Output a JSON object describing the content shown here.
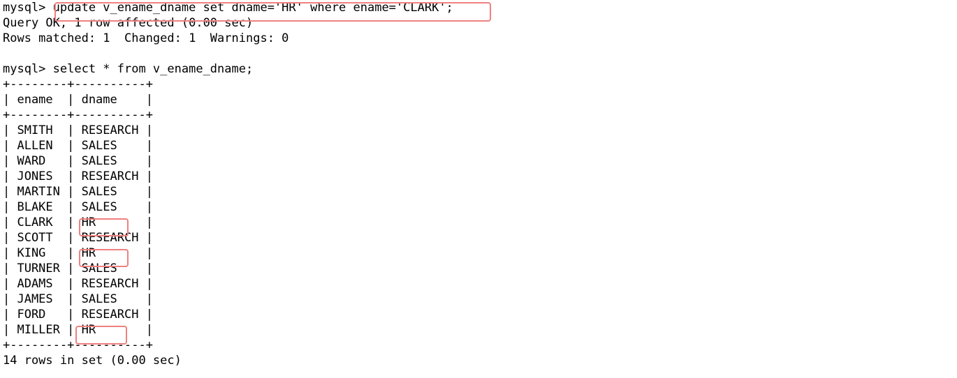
{
  "terminal": {
    "prompt": "mysql>",
    "lines": [
      {
        "id": "cmd-update",
        "text": "mysql> update v_ename_dname set dname='HR' where ename='CLARK';"
      },
      {
        "id": "result-query-ok",
        "text": "Query OK, 1 row affected (0.00 sec)"
      },
      {
        "id": "result-rows-matched",
        "text": "Rows matched: 1  Changed: 1  Warnings: 0"
      },
      {
        "id": "blank-1",
        "text": ""
      },
      {
        "id": "cmd-select",
        "text": "mysql> select * from v_ename_dname;"
      },
      {
        "id": "sep-top",
        "text": "+--------+----------+"
      },
      {
        "id": "header-row",
        "text": "| ename  | dname    |"
      },
      {
        "id": "sep-header",
        "text": "+--------+----------+"
      },
      {
        "id": "row-smith",
        "text": "| SMITH  | RESEARCH |"
      },
      {
        "id": "row-allen",
        "text": "| ALLEN  | SALES    |"
      },
      {
        "id": "row-ward",
        "text": "| WARD   | SALES    |"
      },
      {
        "id": "row-jones",
        "text": "| JONES  | RESEARCH |"
      },
      {
        "id": "row-martin",
        "text": "| MARTIN | SALES    |"
      },
      {
        "id": "row-blake",
        "text": "| BLAKE  | SALES    |"
      },
      {
        "id": "row-clark",
        "text": "| CLARK  | HR       |"
      },
      {
        "id": "row-scott",
        "text": "| SCOTT  | RESEARCH |"
      },
      {
        "id": "row-king",
        "text": "| KING   | HR       |"
      },
      {
        "id": "row-turner",
        "text": "| TURNER | SALES    |"
      },
      {
        "id": "row-adams",
        "text": "| ADAMS  | RESEARCH |"
      },
      {
        "id": "row-james",
        "text": "| JAMES  | SALES    |"
      },
      {
        "id": "row-ford",
        "text": "| FORD   | RESEARCH |"
      },
      {
        "id": "row-miller",
        "text": "| MILLER | HR       |"
      },
      {
        "id": "sep-bottom",
        "text": "+--------+----------+"
      },
      {
        "id": "result-row-count",
        "text": "14 rows in set (0.00 sec)"
      }
    ],
    "table": {
      "columns": [
        "ename",
        "dname"
      ],
      "rows": [
        {
          "ename": "SMITH",
          "dname": "RESEARCH"
        },
        {
          "ename": "ALLEN",
          "dname": "SALES"
        },
        {
          "ename": "WARD",
          "dname": "SALES"
        },
        {
          "ename": "JONES",
          "dname": "RESEARCH"
        },
        {
          "ename": "MARTIN",
          "dname": "SALES"
        },
        {
          "ename": "BLAKE",
          "dname": "SALES"
        },
        {
          "ename": "CLARK",
          "dname": "HR"
        },
        {
          "ename": "SCOTT",
          "dname": "RESEARCH"
        },
        {
          "ename": "KING",
          "dname": "HR"
        },
        {
          "ename": "TURNER",
          "dname": "SALES"
        },
        {
          "ename": "ADAMS",
          "dname": "RESEARCH"
        },
        {
          "ename": "JAMES",
          "dname": "SALES"
        },
        {
          "ename": "FORD",
          "dname": "RESEARCH"
        },
        {
          "ename": "MILLER",
          "dname": "HR"
        }
      ],
      "row_count_label": "14 rows in set (0.00 sec)"
    },
    "highlights": {
      "color": "#f08080",
      "items": [
        {
          "id": "highlight-update-command",
          "label": "update v_ename_dname set dname='HR' where ename='CLARK';"
        },
        {
          "id": "highlight-clark-hr",
          "label": "HR"
        },
        {
          "id": "highlight-king-hr",
          "label": "HR"
        },
        {
          "id": "highlight-miller-hr",
          "label": "HR"
        }
      ]
    },
    "colors": {
      "background": "#ffffff",
      "text": "#000000",
      "highlight_border": "#f08080"
    }
  }
}
